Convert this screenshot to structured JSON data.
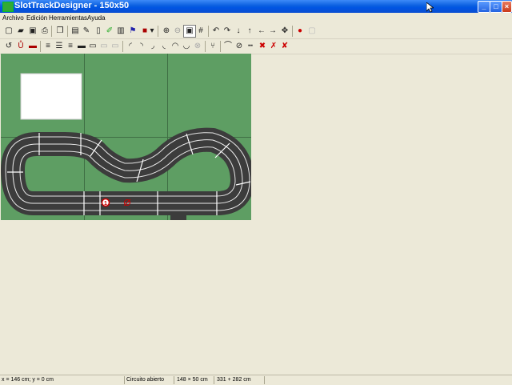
{
  "window": {
    "title": "SlotTrackDesigner - 150x50",
    "minimize_glyph": "_",
    "maximize_glyph": "□",
    "close_glyph": "×"
  },
  "menu": [
    "Archivo",
    "Edición",
    "Herramientas",
    "Ayuda"
  ],
  "toolbar1_icons": [
    "new-icon",
    "open-icon",
    "save-icon",
    "print-icon",
    "copy-icon",
    "document-icon",
    "wrench-icon",
    "page-icon",
    "pencil-icon",
    "print2-icon",
    "flag-icon",
    "color-icon",
    "dropdown-icon",
    "zoom-in-icon",
    "zoom-out-icon",
    "zoom-fit-icon",
    "grid-icon",
    "rotate-left-icon",
    "rotate-right-icon",
    "arrow-down-icon",
    "arrow-up-icon",
    "arrow-left-icon",
    "arrow-right-icon",
    "move-icon",
    "palette-icon",
    "disabled-icon"
  ],
  "toolbar2_icons": [
    "undo-icon",
    "magnet-icon",
    "barrier-icon",
    "straight1-icon",
    "straight2-icon",
    "straight3-icon",
    "straight4-icon",
    "straight5-icon",
    "straight6-icon",
    "straight7-icon",
    "curve1-icon",
    "curve2-icon",
    "curve3-icon",
    "curve4-icon",
    "curve5-icon",
    "curve6-icon",
    "crossing-icon",
    "lane-change1-icon",
    "lane-change2-icon",
    "border-icon",
    "delete-icon",
    "delete2-icon",
    "delete3-icon"
  ],
  "canvas": {
    "background": "#5E9E63",
    "track_color": "#3c3c3c",
    "lane_line_color": "#ffffff",
    "start_marker": "1",
    "start_marker_color": "#cc0000"
  },
  "status": {
    "coords": "x = 146 cm; y = 0 cm",
    "state": "Circuito abierto",
    "size": "148 × 50 cm",
    "length": "331 + 282 cm"
  }
}
